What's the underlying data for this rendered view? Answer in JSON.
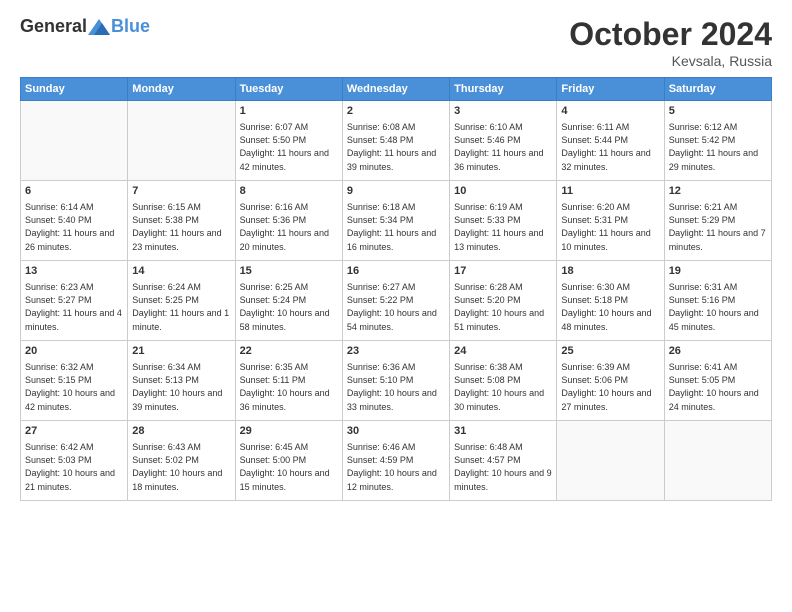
{
  "header": {
    "logo_general": "General",
    "logo_blue": "Blue",
    "month": "October 2024",
    "location": "Kevsala, Russia"
  },
  "weekdays": [
    "Sunday",
    "Monday",
    "Tuesday",
    "Wednesday",
    "Thursday",
    "Friday",
    "Saturday"
  ],
  "weeks": [
    [
      {
        "day": "",
        "sunrise": "",
        "sunset": "",
        "daylight": ""
      },
      {
        "day": "",
        "sunrise": "",
        "sunset": "",
        "daylight": ""
      },
      {
        "day": "1",
        "sunrise": "Sunrise: 6:07 AM",
        "sunset": "Sunset: 5:50 PM",
        "daylight": "Daylight: 11 hours and 42 minutes."
      },
      {
        "day": "2",
        "sunrise": "Sunrise: 6:08 AM",
        "sunset": "Sunset: 5:48 PM",
        "daylight": "Daylight: 11 hours and 39 minutes."
      },
      {
        "day": "3",
        "sunrise": "Sunrise: 6:10 AM",
        "sunset": "Sunset: 5:46 PM",
        "daylight": "Daylight: 11 hours and 36 minutes."
      },
      {
        "day": "4",
        "sunrise": "Sunrise: 6:11 AM",
        "sunset": "Sunset: 5:44 PM",
        "daylight": "Daylight: 11 hours and 32 minutes."
      },
      {
        "day": "5",
        "sunrise": "Sunrise: 6:12 AM",
        "sunset": "Sunset: 5:42 PM",
        "daylight": "Daylight: 11 hours and 29 minutes."
      }
    ],
    [
      {
        "day": "6",
        "sunrise": "Sunrise: 6:14 AM",
        "sunset": "Sunset: 5:40 PM",
        "daylight": "Daylight: 11 hours and 26 minutes."
      },
      {
        "day": "7",
        "sunrise": "Sunrise: 6:15 AM",
        "sunset": "Sunset: 5:38 PM",
        "daylight": "Daylight: 11 hours and 23 minutes."
      },
      {
        "day": "8",
        "sunrise": "Sunrise: 6:16 AM",
        "sunset": "Sunset: 5:36 PM",
        "daylight": "Daylight: 11 hours and 20 minutes."
      },
      {
        "day": "9",
        "sunrise": "Sunrise: 6:18 AM",
        "sunset": "Sunset: 5:34 PM",
        "daylight": "Daylight: 11 hours and 16 minutes."
      },
      {
        "day": "10",
        "sunrise": "Sunrise: 6:19 AM",
        "sunset": "Sunset: 5:33 PM",
        "daylight": "Daylight: 11 hours and 13 minutes."
      },
      {
        "day": "11",
        "sunrise": "Sunrise: 6:20 AM",
        "sunset": "Sunset: 5:31 PM",
        "daylight": "Daylight: 11 hours and 10 minutes."
      },
      {
        "day": "12",
        "sunrise": "Sunrise: 6:21 AM",
        "sunset": "Sunset: 5:29 PM",
        "daylight": "Daylight: 11 hours and 7 minutes."
      }
    ],
    [
      {
        "day": "13",
        "sunrise": "Sunrise: 6:23 AM",
        "sunset": "Sunset: 5:27 PM",
        "daylight": "Daylight: 11 hours and 4 minutes."
      },
      {
        "day": "14",
        "sunrise": "Sunrise: 6:24 AM",
        "sunset": "Sunset: 5:25 PM",
        "daylight": "Daylight: 11 hours and 1 minute."
      },
      {
        "day": "15",
        "sunrise": "Sunrise: 6:25 AM",
        "sunset": "Sunset: 5:24 PM",
        "daylight": "Daylight: 10 hours and 58 minutes."
      },
      {
        "day": "16",
        "sunrise": "Sunrise: 6:27 AM",
        "sunset": "Sunset: 5:22 PM",
        "daylight": "Daylight: 10 hours and 54 minutes."
      },
      {
        "day": "17",
        "sunrise": "Sunrise: 6:28 AM",
        "sunset": "Sunset: 5:20 PM",
        "daylight": "Daylight: 10 hours and 51 minutes."
      },
      {
        "day": "18",
        "sunrise": "Sunrise: 6:30 AM",
        "sunset": "Sunset: 5:18 PM",
        "daylight": "Daylight: 10 hours and 48 minutes."
      },
      {
        "day": "19",
        "sunrise": "Sunrise: 6:31 AM",
        "sunset": "Sunset: 5:16 PM",
        "daylight": "Daylight: 10 hours and 45 minutes."
      }
    ],
    [
      {
        "day": "20",
        "sunrise": "Sunrise: 6:32 AM",
        "sunset": "Sunset: 5:15 PM",
        "daylight": "Daylight: 10 hours and 42 minutes."
      },
      {
        "day": "21",
        "sunrise": "Sunrise: 6:34 AM",
        "sunset": "Sunset: 5:13 PM",
        "daylight": "Daylight: 10 hours and 39 minutes."
      },
      {
        "day": "22",
        "sunrise": "Sunrise: 6:35 AM",
        "sunset": "Sunset: 5:11 PM",
        "daylight": "Daylight: 10 hours and 36 minutes."
      },
      {
        "day": "23",
        "sunrise": "Sunrise: 6:36 AM",
        "sunset": "Sunset: 5:10 PM",
        "daylight": "Daylight: 10 hours and 33 minutes."
      },
      {
        "day": "24",
        "sunrise": "Sunrise: 6:38 AM",
        "sunset": "Sunset: 5:08 PM",
        "daylight": "Daylight: 10 hours and 30 minutes."
      },
      {
        "day": "25",
        "sunrise": "Sunrise: 6:39 AM",
        "sunset": "Sunset: 5:06 PM",
        "daylight": "Daylight: 10 hours and 27 minutes."
      },
      {
        "day": "26",
        "sunrise": "Sunrise: 6:41 AM",
        "sunset": "Sunset: 5:05 PM",
        "daylight": "Daylight: 10 hours and 24 minutes."
      }
    ],
    [
      {
        "day": "27",
        "sunrise": "Sunrise: 6:42 AM",
        "sunset": "Sunset: 5:03 PM",
        "daylight": "Daylight: 10 hours and 21 minutes."
      },
      {
        "day": "28",
        "sunrise": "Sunrise: 6:43 AM",
        "sunset": "Sunset: 5:02 PM",
        "daylight": "Daylight: 10 hours and 18 minutes."
      },
      {
        "day": "29",
        "sunrise": "Sunrise: 6:45 AM",
        "sunset": "Sunset: 5:00 PM",
        "daylight": "Daylight: 10 hours and 15 minutes."
      },
      {
        "day": "30",
        "sunrise": "Sunrise: 6:46 AM",
        "sunset": "Sunset: 4:59 PM",
        "daylight": "Daylight: 10 hours and 12 minutes."
      },
      {
        "day": "31",
        "sunrise": "Sunrise: 6:48 AM",
        "sunset": "Sunset: 4:57 PM",
        "daylight": "Daylight: 10 hours and 9 minutes."
      },
      {
        "day": "",
        "sunrise": "",
        "sunset": "",
        "daylight": ""
      },
      {
        "day": "",
        "sunrise": "",
        "sunset": "",
        "daylight": ""
      }
    ]
  ]
}
